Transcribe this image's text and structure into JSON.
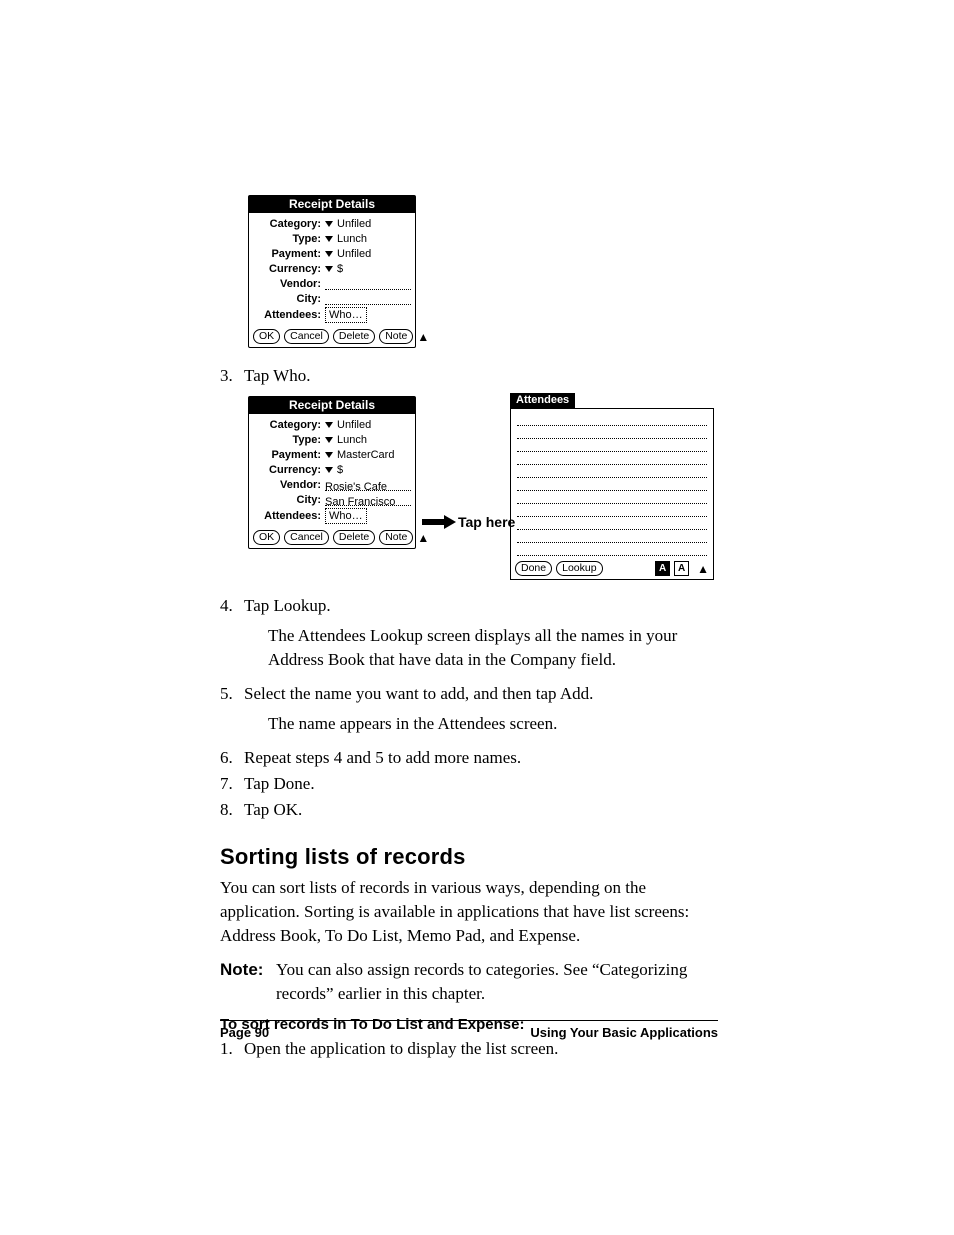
{
  "figure1": {
    "title": "Receipt Details",
    "fields": {
      "category": {
        "label": "Category:",
        "value": "Unfiled"
      },
      "type": {
        "label": "Type:",
        "value": "Lunch"
      },
      "payment": {
        "label": "Payment:",
        "value": "Unfiled"
      },
      "currency": {
        "label": "Currency:",
        "value": "$"
      },
      "vendor": {
        "label": "Vendor:",
        "value": ""
      },
      "city": {
        "label": "City:",
        "value": ""
      },
      "attendees": {
        "label": "Attendees:",
        "who_label": "Who…"
      }
    },
    "buttons": {
      "ok": "OK",
      "cancel": "Cancel",
      "delete": "Delete",
      "note": "Note"
    }
  },
  "figure2": {
    "title": "Receipt Details",
    "fields": {
      "category": {
        "label": "Category:",
        "value": "Unfiled"
      },
      "type": {
        "label": "Type:",
        "value": "Lunch"
      },
      "payment": {
        "label": "Payment:",
        "value": "MasterCard"
      },
      "currency": {
        "label": "Currency:",
        "value": "$"
      },
      "vendor": {
        "label": "Vendor:",
        "value": "Rosie's Cafe"
      },
      "city": {
        "label": "City:",
        "value": "San Francisco"
      },
      "attendees": {
        "label": "Attendees:",
        "who_label": "Who…"
      }
    },
    "buttons": {
      "ok": "OK",
      "cancel": "Cancel",
      "delete": "Delete",
      "note": "Note"
    },
    "callout": "Tap here"
  },
  "attendees_panel": {
    "title": "Attendees",
    "buttons": {
      "done": "Done",
      "lookup": "Lookup"
    },
    "indicators": {
      "boldA": "A",
      "plainA": "A"
    }
  },
  "steps": {
    "s3": "Tap Who.",
    "s4": "Tap Lookup.",
    "s4_sub": "The Attendees Lookup screen displays all the names in your Address Book that have data in the Company field.",
    "s5": "Select the name you want to add, and then tap Add.",
    "s5_sub": "The name appears in the Attendees screen.",
    "s6": "Repeat steps 4 and 5 to add more names.",
    "s7": "Tap Done.",
    "s8": "Tap OK."
  },
  "section": {
    "heading": "Sorting lists of records",
    "para": "You can sort lists of records in various ways, depending on the application. Sorting is available in applications that have list screens: Address Book, To Do List, Memo Pad, and Expense.",
    "note_label": "Note:",
    "note_text": "You can also assign records to categories. See “Categorizing records” earlier in this chapter.",
    "subhead": "To sort records in To Do List and Expense:",
    "step1": "Open the application to display the list screen."
  },
  "footer": {
    "left": "Page 90",
    "right": "Using Your Basic Applications"
  }
}
